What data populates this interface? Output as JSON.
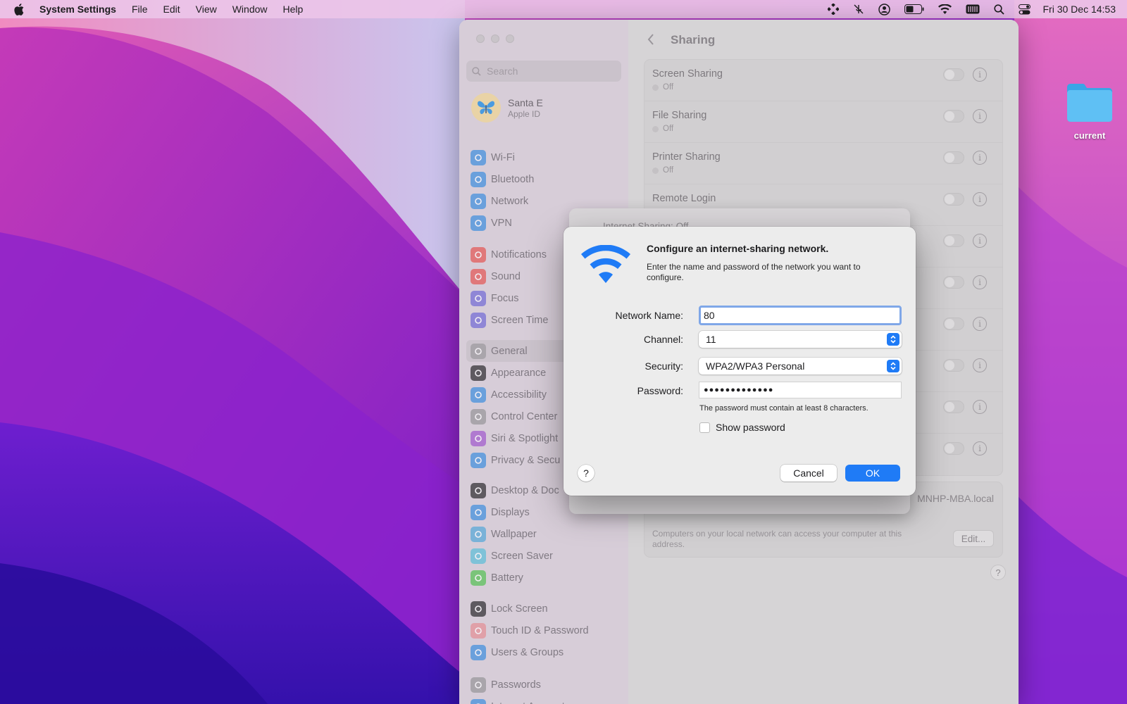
{
  "menubar": {
    "app_name": "System Settings",
    "items": [
      "File",
      "Edit",
      "View",
      "Window",
      "Help"
    ],
    "clock": "Fri 30 Dec  14:53"
  },
  "desktop": {
    "folder_label": "current"
  },
  "window": {
    "search_placeholder": "Search",
    "account": {
      "name": "Santa E",
      "subtitle": "Apple ID"
    },
    "sidebar_groups": [
      [
        {
          "label": "Wi-Fi",
          "icon": "wifi-icon",
          "color": "#6aa0dc"
        },
        {
          "label": "Bluetooth",
          "icon": "bluetooth-icon",
          "color": "#6aa0dc"
        },
        {
          "label": "Network",
          "icon": "globe-icon",
          "color": "#6aa0dc"
        },
        {
          "label": "VPN",
          "icon": "globe-icon",
          "color": "#6aa0dc"
        }
      ],
      [
        {
          "label": "Notifications",
          "icon": "bell-icon",
          "color": "#e0787a"
        },
        {
          "label": "Sound",
          "icon": "speaker-icon",
          "color": "#e0787a"
        },
        {
          "label": "Focus",
          "icon": "moon-icon",
          "color": "#8f86d6"
        },
        {
          "label": "Screen Time",
          "icon": "hourglass-icon",
          "color": "#8f86d6"
        }
      ],
      [
        {
          "label": "General",
          "icon": "gear-icon",
          "color": "#a9a5ab",
          "selected": true
        },
        {
          "label": "Appearance",
          "icon": "appearance-icon",
          "color": "#5e5a60"
        },
        {
          "label": "Accessibility",
          "icon": "accessibility-icon",
          "color": "#6aa0dc"
        },
        {
          "label": "Control Center",
          "icon": "toggles-icon",
          "color": "#a9a5ab"
        },
        {
          "label": "Siri & Spotlight",
          "icon": "siri-icon",
          "color": "#b07ad0"
        },
        {
          "label": "Privacy & Secu",
          "icon": "hand-icon",
          "color": "#6aa0dc"
        }
      ],
      [
        {
          "label": "Desktop & Doc",
          "icon": "desktop-icon",
          "color": "#5e5a60"
        },
        {
          "label": "Displays",
          "icon": "sun-icon",
          "color": "#6aa0dc"
        },
        {
          "label": "Wallpaper",
          "icon": "flower-icon",
          "color": "#7ab2d8"
        },
        {
          "label": "Screen Saver",
          "icon": "screensaver-icon",
          "color": "#7fc2d8"
        },
        {
          "label": "Battery",
          "icon": "battery-icon",
          "color": "#7ac47a"
        }
      ],
      [
        {
          "label": "Lock Screen",
          "icon": "lock-icon",
          "color": "#5e5a60"
        },
        {
          "label": "Touch ID & Password",
          "icon": "fingerprint-icon",
          "color": "#e0a0a8"
        },
        {
          "label": "Users & Groups",
          "icon": "users-icon",
          "color": "#6aa0dc"
        }
      ],
      [
        {
          "label": "Passwords",
          "icon": "key-icon",
          "color": "#a9a5ab"
        },
        {
          "label": "Internet Accounts",
          "icon": "at-icon",
          "color": "#6aa0dc"
        }
      ]
    ],
    "main": {
      "title": "Sharing",
      "services": [
        {
          "title": "Screen Sharing",
          "status": "Off"
        },
        {
          "title": "File Sharing",
          "status": "Off"
        },
        {
          "title": "Printer Sharing",
          "status": "Off"
        },
        {
          "title": "Remote Login",
          "status": ""
        },
        {
          "title": "",
          "status": ""
        },
        {
          "title": "",
          "status": ""
        },
        {
          "title": "",
          "status": ""
        },
        {
          "title": "",
          "status": ""
        },
        {
          "title": "",
          "status": ""
        },
        {
          "title": "",
          "status": ""
        }
      ],
      "hostname": "MNHP-MBA.local",
      "hostname_desc": "Computers on your local network can access your computer at this address.",
      "edit_label": "Edit...",
      "help_label": "?"
    }
  },
  "sheet_back": {
    "title": "Internet Sharing: Off"
  },
  "dialog": {
    "title": "Configure an internet-sharing network.",
    "description": "Enter the name and password of the network you want to configure.",
    "network_name_label": "Network Name:",
    "network_name_value": "80",
    "channel_label": "Channel:",
    "channel_value": "11",
    "security_label": "Security:",
    "security_value": "WPA2/WPA3 Personal",
    "password_label": "Password:",
    "password_value": "●●●●●●●●●●●●●",
    "password_hint": "The password must contain at least 8 characters.",
    "show_password_label": "Show password",
    "help_label": "?",
    "cancel_label": "Cancel",
    "ok_label": "OK",
    "accent_color": "#1f7bf6"
  }
}
